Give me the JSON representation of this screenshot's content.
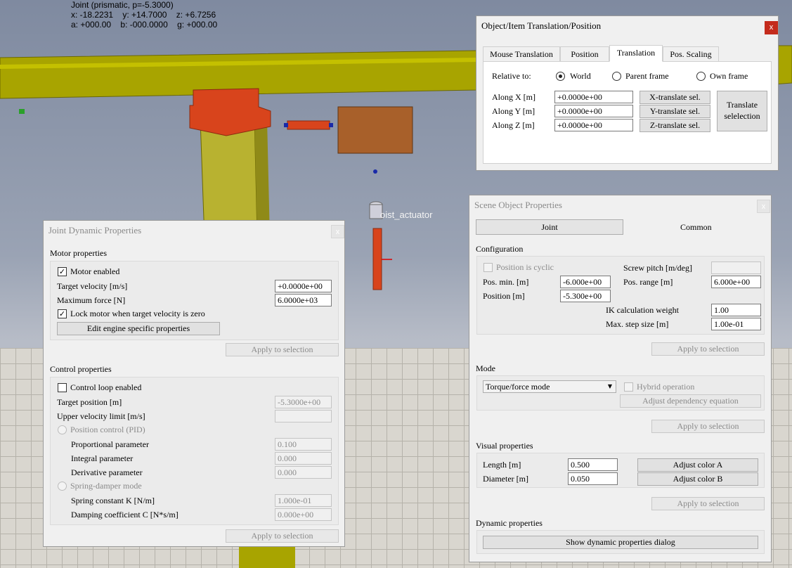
{
  "overlay": {
    "line1": "Joint (prismatic, p=-5.3000)",
    "line2": "x: -18.2231    y: +14.7000    z: +6.7256",
    "line3": "a: +000.00    b: -000.0000    g: +000.00",
    "scene_label": "oist_actuator"
  },
  "translation_dialog": {
    "title": "Object/Item Translation/Position",
    "close": "x",
    "tabs": [
      "Mouse Translation",
      "Position",
      "Translation",
      "Pos. Scaling"
    ],
    "relative_to_label": "Relative to:",
    "options": [
      "World",
      "Parent frame",
      "Own frame"
    ],
    "rows": [
      {
        "label": "Along X [m]",
        "value": "+0.0000e+00",
        "button": "X-translate sel."
      },
      {
        "label": "Along Y [m]",
        "value": "+0.0000e+00",
        "button": "Y-translate sel."
      },
      {
        "label": "Along Z [m]",
        "value": "+0.0000e+00",
        "button": "Z-translate sel."
      }
    ],
    "translate_button_line1": "Translate",
    "translate_button_line2": "selelection"
  },
  "joint_dyn": {
    "title": "Joint Dynamic Properties",
    "close": "x",
    "motor_header": "Motor properties",
    "motor_enabled": "Motor enabled",
    "target_velocity_label": "Target velocity [m/s]",
    "target_velocity": "+0.0000e+00",
    "max_force_label": "Maximum force [N]",
    "max_force": "6.0000e+03",
    "lock_motor": "Lock motor when target velocity is zero",
    "edit_engine": "Edit engine specific properties",
    "apply1": "Apply to selection",
    "control_header": "Control properties",
    "control_loop": "Control loop enabled",
    "target_position_label": "Target position [m]",
    "target_position": "-5.3000e+00",
    "upper_velocity_label": "Upper velocity limit [m/s]",
    "pid_mode": "Position control (PID)",
    "prop_label": "Proportional parameter",
    "prop_value": "0.100",
    "integral_label": "Integral parameter",
    "integral_value": "0.000",
    "deriv_label": "Derivative parameter",
    "deriv_value": "0.000",
    "spring_mode": "Spring-damper mode",
    "spring_k_label": "Spring constant K [N/m]",
    "spring_k": "1.000e-01",
    "damping_label": "Damping coefficient C [N*s/m]",
    "damping": "0.000e+00",
    "apply2": "Apply to selection"
  },
  "scene_props": {
    "title": "Scene Object Properties",
    "close": "x",
    "tab_joint": "Joint",
    "tab_common": "Common",
    "config_header": "Configuration",
    "cyclic": "Position is cyclic",
    "screw_label": "Screw pitch [m/deg]",
    "pos_min_label": "Pos. min. [m]",
    "pos_min": "-6.000e+00",
    "pos_range_label": "Pos. range [m]",
    "pos_range": "6.000e+00",
    "position_label": "Position [m]",
    "position": "-5.300e+00",
    "ik_label": "IK calculation weight",
    "ik_value": "1.00",
    "step_label": "Max. step size [m]",
    "step_value": "1.00e-01",
    "apply1": "Apply to selection",
    "mode_header": "Mode",
    "mode_value": "Torque/force mode",
    "hybrid": "Hybrid operation",
    "adjust_dep": "Adjust dependency equation",
    "apply2": "Apply to selection",
    "visual_header": "Visual properties",
    "length_label": "Length [m]",
    "length": "0.500",
    "diameter_label": "Diameter [m]",
    "diameter": "0.050",
    "color_a": "Adjust color A",
    "color_b": "Adjust color B",
    "apply3": "Apply to selection",
    "dynamic_header": "Dynamic properties",
    "show_dynamic": "Show dynamic properties dialog"
  },
  "colors": {
    "beam": "#a8a400",
    "orange": "#d8441c",
    "brown": "#a8602a",
    "close_red": "#c42b1c"
  }
}
